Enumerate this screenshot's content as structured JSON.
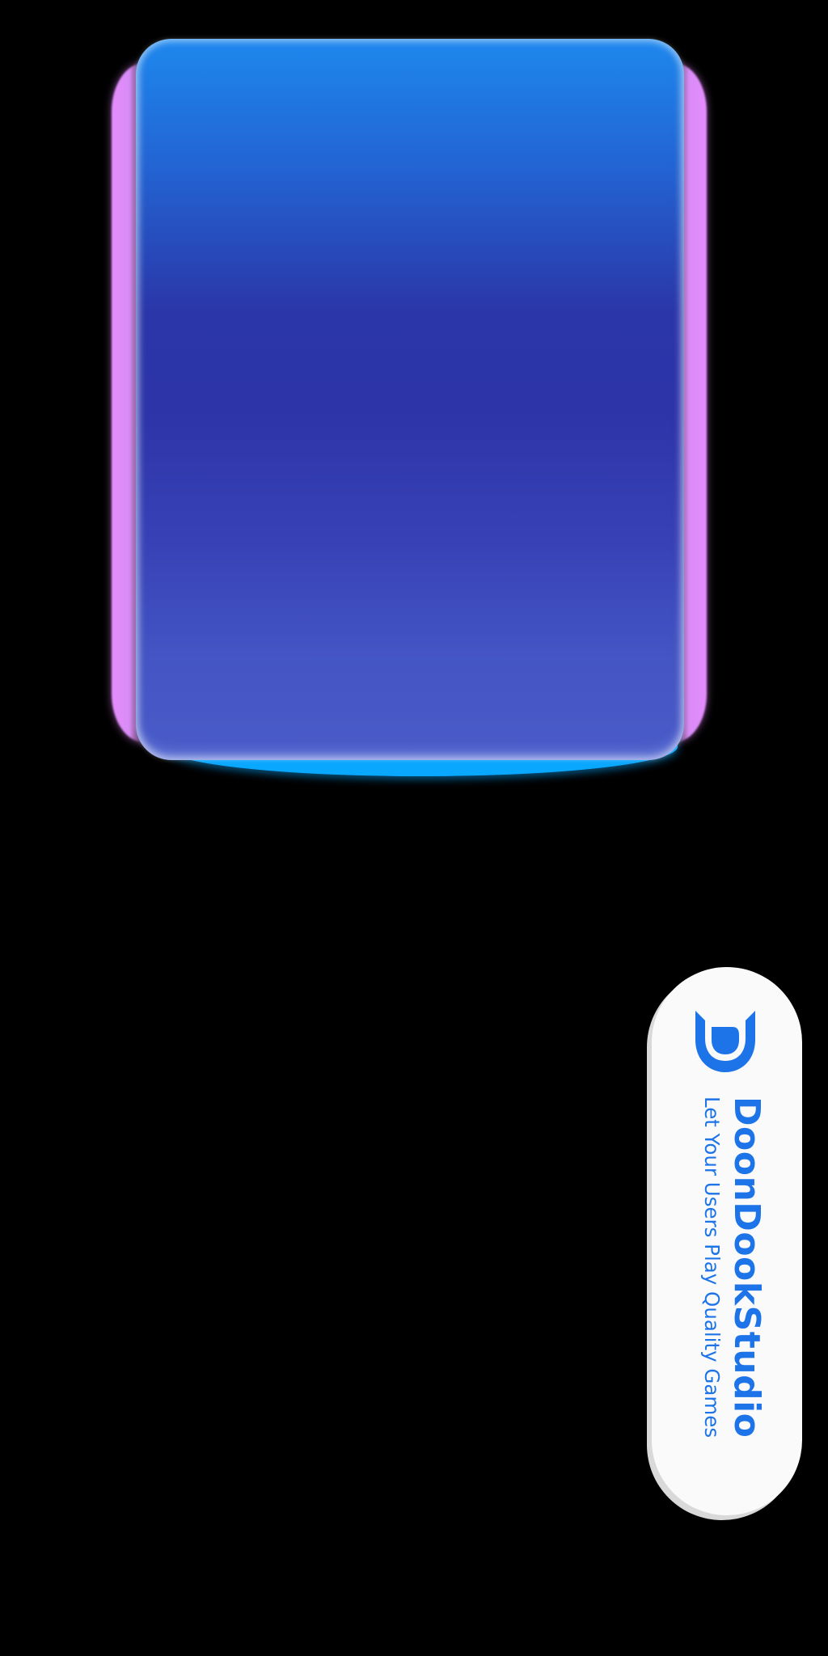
{
  "brand": {
    "name": "DoonDookStudio",
    "tagline": "Let Your Users Play Quality Games",
    "logo_icon": "doondook-d-logo-icon",
    "accent_color": "#1d74e8"
  },
  "panel": {
    "gradient_top": "#1e88ee",
    "gradient_mid": "#2b36a8",
    "gradient_bottom": "#4a5cc8",
    "glow_side_color": "#e58cff",
    "glow_bottom_color": "#0aa7ff"
  },
  "background_color": "#000000"
}
